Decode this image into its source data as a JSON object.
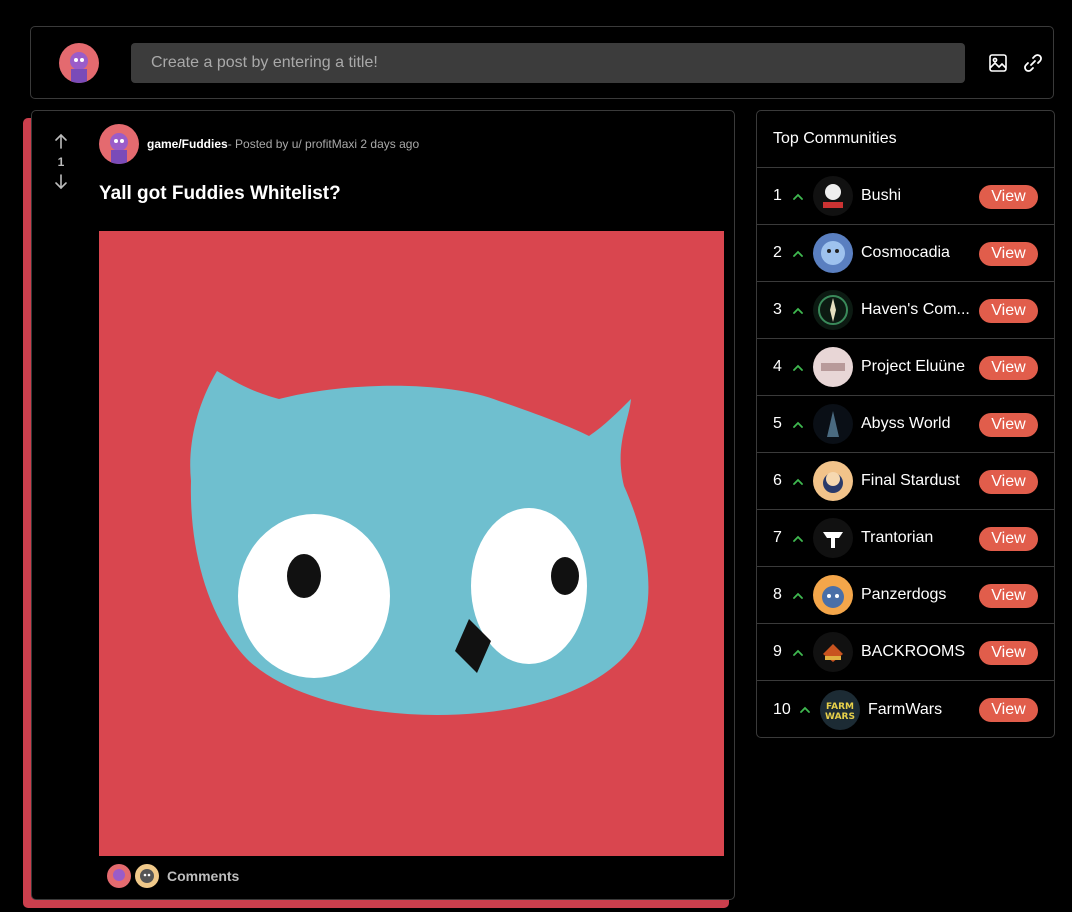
{
  "create_post": {
    "placeholder": "Create a post by entering a title!"
  },
  "post": {
    "vote_count": "1",
    "community": "game/Fuddies",
    "byline": "- Posted by u/ profitMaxi 2 days ago",
    "title": "Yall got Fuddies Whitelist?",
    "comments_label": "Comments"
  },
  "sidebar": {
    "title": "Top Communities",
    "view_label": "View",
    "communities": [
      {
        "rank": "1",
        "name": "Bushi"
      },
      {
        "rank": "2",
        "name": "Cosmocadia"
      },
      {
        "rank": "3",
        "name": "Haven's Com..."
      },
      {
        "rank": "4",
        "name": "Project Eluüne"
      },
      {
        "rank": "5",
        "name": "Abyss World"
      },
      {
        "rank": "6",
        "name": "Final Stardust"
      },
      {
        "rank": "7",
        "name": "Trantorian"
      },
      {
        "rank": "8",
        "name": "Panzerdogs"
      },
      {
        "rank": "9",
        "name": "BACKROOMS"
      },
      {
        "rank": "10",
        "name": "FarmWars"
      }
    ]
  },
  "colors": {
    "accent": "#e15d4b",
    "post_shadow": "#cb3f4d",
    "image_bg": "#d9464f",
    "owl": "#6fbfcf",
    "up_caret": "#3fb950"
  }
}
